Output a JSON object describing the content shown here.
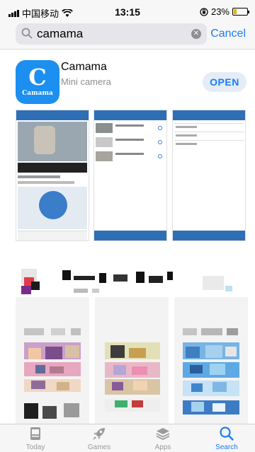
{
  "status_bar": {
    "carrier": "中国移动",
    "time": "13:15",
    "battery_percent": "23%",
    "battery_level": 0.23,
    "icons": [
      "signal-icon",
      "wifi-icon",
      "orientation-lock-icon",
      "battery-icon"
    ]
  },
  "search": {
    "query": "camama",
    "cancel_label": "Cancel",
    "icon": "search-icon",
    "clear_icon": "clear-icon"
  },
  "result": {
    "icon_letter": "C",
    "icon_wordmark": "Camama",
    "name": "Camama",
    "subtitle": "Mini camera",
    "action_label": "OPEN",
    "accent": "#1a7cf5",
    "icon_color": "#1c8ff0"
  },
  "tab_bar": {
    "items": [
      {
        "label": "Today",
        "icon": "today-icon",
        "active": false
      },
      {
        "label": "Games",
        "icon": "rocket-icon",
        "active": false
      },
      {
        "label": "Apps",
        "icon": "apps-layers-icon",
        "active": false
      },
      {
        "label": "Search",
        "icon": "search-icon",
        "active": true
      }
    ]
  }
}
